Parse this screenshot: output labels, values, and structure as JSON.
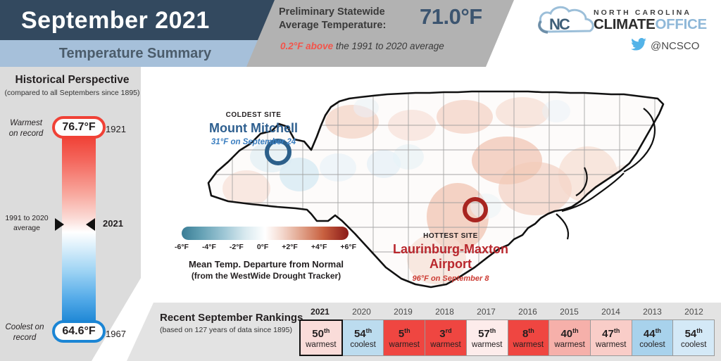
{
  "header": {
    "month_title": "September 2021",
    "summary_title": "Temperature Summary",
    "prelim_label_line1": "Preliminary Statewide",
    "prelim_label_line2": "Average Temperature:",
    "average_temperature": "71.0°F",
    "departure_value": "0.2°F above",
    "departure_rest": " the 1991 to 2020 average"
  },
  "logo": {
    "line_top": "NORTH CAROLINA",
    "name_bold": "CLIMATE",
    "name_light": "OFFICE",
    "twitter_handle": "@NCSCO"
  },
  "historical": {
    "title": "Historical Perspective",
    "subtitle": "(compared to all Septembers since 1895)",
    "warmest_label_line1": "Warmest",
    "warmest_label_line2": "on record",
    "warmest_value": "76.7°F",
    "warmest_year": "1921",
    "coolest_label_line1": "Coolest on",
    "coolest_label_line2": "record",
    "coolest_value": "64.6°F",
    "coolest_year": "1967",
    "average_label_line1": "1991 to 2020",
    "average_label_line2": "average",
    "current_year_label": "2021"
  },
  "map": {
    "coldest_kicker": "COLDEST SITE",
    "coldest_site": "Mount Mitchell",
    "coldest_detail": "31°F on September 24",
    "hottest_kicker": "HOTTEST SITE",
    "hottest_site_line1": "Laurinburg-Maxton",
    "hottest_site_line2": "Airport",
    "hottest_detail": "96°F on September 8",
    "colorbar_ticks": [
      "-6°F",
      "-4°F",
      "-2°F",
      "0°F",
      "+2°F",
      "+4°F",
      "+6°F"
    ],
    "colorbar_caption1": "Mean Temp. Departure from Normal",
    "colorbar_caption2": "(from the WestWide Drought Tracker)"
  },
  "rankings": {
    "title": "Recent September Rankings",
    "subtitle": "(based on 127 years of data since 1895)",
    "items": [
      {
        "year": "2021",
        "rank": "50",
        "suffix": "th",
        "word": "warmest",
        "color": "#fadcd9",
        "current": true
      },
      {
        "year": "2020",
        "rank": "54",
        "suffix": "th",
        "word": "coolest",
        "color": "#bcdcef",
        "current": false
      },
      {
        "year": "2019",
        "rank": "5",
        "suffix": "th",
        "word": "warmest",
        "color": "#ef4641",
        "current": false
      },
      {
        "year": "2018",
        "rank": "3",
        "suffix": "rd",
        "word": "warmest",
        "color": "#ef4641",
        "current": false
      },
      {
        "year": "2017",
        "rank": "57",
        "suffix": "th",
        "word": "warmest",
        "color": "#fdeceb",
        "current": false
      },
      {
        "year": "2016",
        "rank": "8",
        "suffix": "th",
        "word": "warmest",
        "color": "#ef4641",
        "current": false
      },
      {
        "year": "2015",
        "rank": "40",
        "suffix": "th",
        "word": "warmest",
        "color": "#f6b0aa",
        "current": false
      },
      {
        "year": "2014",
        "rank": "47",
        "suffix": "th",
        "word": "warmest",
        "color": "#f9cdc8",
        "current": false
      },
      {
        "year": "2013",
        "rank": "44",
        "suffix": "th",
        "word": "coolest",
        "color": "#a8d2ec",
        "current": false
      },
      {
        "year": "2012",
        "rank": "54",
        "suffix": "th",
        "word": "coolest",
        "color": "#d4e9f7",
        "current": false
      }
    ]
  },
  "colors": {
    "navy": "#33495f",
    "light_blue_band": "#a6c0da",
    "grey_band": "#b2b2b2",
    "panel_grey": "#dcdcdc",
    "hot_red": "#f04136",
    "cool_blue": "#1b85d4"
  }
}
